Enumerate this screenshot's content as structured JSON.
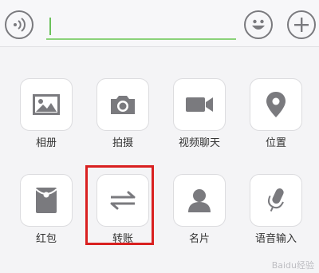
{
  "icons": {
    "voice": "voice-icon",
    "emoji": "emoji-icon",
    "plus": "plus-icon"
  },
  "input": {
    "value": ""
  },
  "panel": {
    "items": [
      {
        "label": "相册",
        "icon": "photo-album-icon"
      },
      {
        "label": "拍摄",
        "icon": "camera-icon"
      },
      {
        "label": "视频聊天",
        "icon": "video-call-icon"
      },
      {
        "label": "位置",
        "icon": "location-pin-icon"
      },
      {
        "label": "红包",
        "icon": "red-packet-icon"
      },
      {
        "label": "转账",
        "icon": "transfer-icon"
      },
      {
        "label": "名片",
        "icon": "contact-card-icon"
      },
      {
        "label": "语音输入",
        "icon": "voice-input-icon"
      }
    ]
  },
  "colors": {
    "icon_gray": "#7a7a7e",
    "highlight": "#d92020",
    "accent": "#6ac15a"
  },
  "watermark": "Baidu经验"
}
